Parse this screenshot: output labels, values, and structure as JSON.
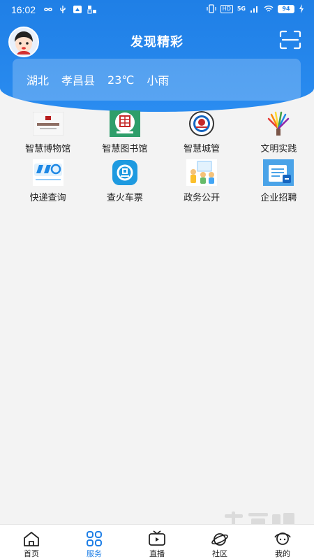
{
  "status_bar": {
    "time": "16:02",
    "network_badge": "HD",
    "signal_label": "5G",
    "battery_level": "94"
  },
  "header": {
    "title": "发现精彩",
    "avatar_icon": "avatar-icon",
    "scan_icon": "scan-icon"
  },
  "weather": {
    "province": "湖北",
    "county": "孝昌县",
    "temperature": "23℃",
    "condition": "小雨"
  },
  "services": [
    {
      "label": "智慧博物馆",
      "icon": "museum-icon"
    },
    {
      "label": "智慧图书馆",
      "icon": "library-icon"
    },
    {
      "label": "智慧城管",
      "icon": "city-management-icon"
    },
    {
      "label": "文明实践",
      "icon": "civilization-practice-icon"
    },
    {
      "label": "快递查询",
      "icon": "express-query-icon"
    },
    {
      "label": "查火车票",
      "icon": "train-ticket-icon"
    },
    {
      "label": "政务公开",
      "icon": "government-affairs-icon"
    },
    {
      "label": "企业招聘",
      "icon": "recruitment-icon"
    }
  ],
  "bottom_nav": {
    "items": [
      {
        "label": "首页",
        "icon": "home-icon"
      },
      {
        "label": "服务",
        "icon": "services-icon",
        "active": true
      },
      {
        "label": "直播",
        "icon": "live-tv-icon"
      },
      {
        "label": "社区",
        "icon": "community-icon"
      },
      {
        "label": "我的",
        "icon": "profile-icon"
      }
    ]
  },
  "colors": {
    "primary": "#1f7fe6",
    "background": "#f3f3f3"
  }
}
